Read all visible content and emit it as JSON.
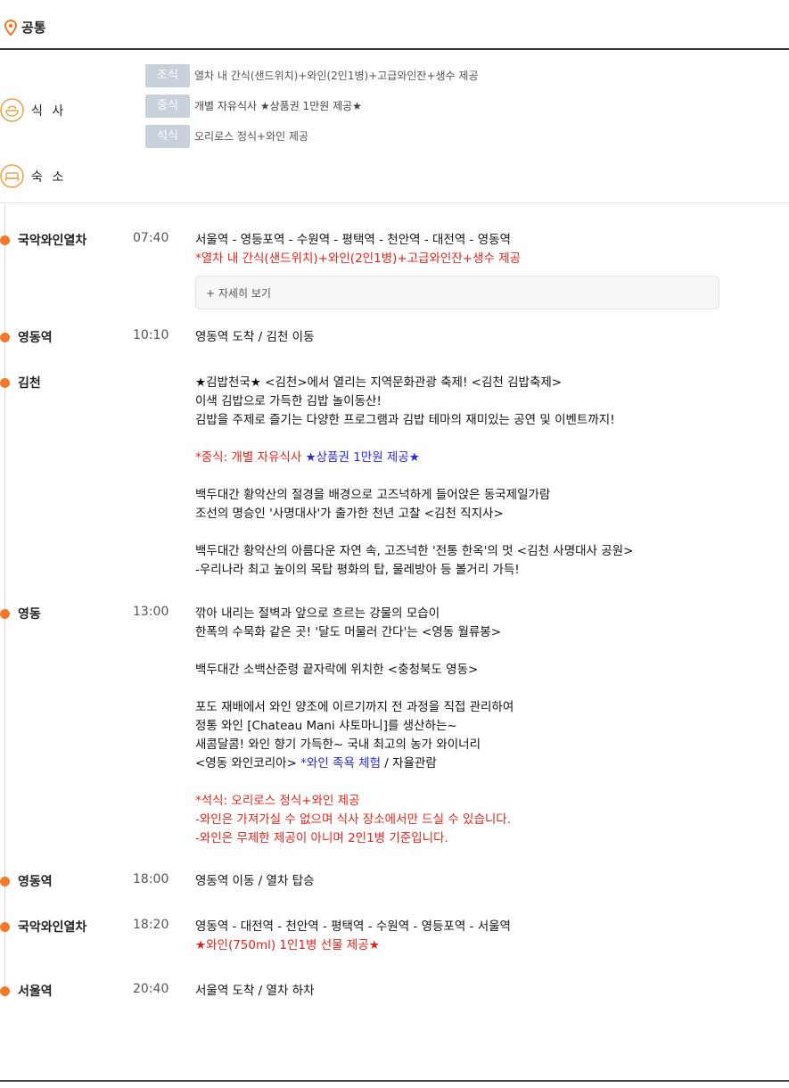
{
  "header": {
    "title": "공통"
  },
  "meals": {
    "label": "식 사",
    "rows": [
      {
        "tag": "조식",
        "text": "열차 내 간식(샌드위치)+와인(2인1병)+고급와인잔+생수 제공"
      },
      {
        "tag": "중식",
        "text": "개별 자유식사 ★상품권 1만원 제공★"
      },
      {
        "tag": "석식",
        "text": "오리로스 정식+와인 제공"
      }
    ]
  },
  "lodging": {
    "label": "숙 소"
  },
  "colors": {
    "accent": "#f07a2a",
    "red": "#e0241b",
    "blue": "#2a2ad6",
    "tag_bg": "#c8d0da"
  },
  "stops": [
    {
      "place": "국악와인열차",
      "time": "07:40",
      "line1": "서울역 - 영등포역 - 수원역 - 평택역 - 천안역 - 대전역 - 영동역",
      "line2": "*열차 내 간식(샌드위치)+와인(2인1병)+고급와인잔+생수 제공",
      "more": "+ 자세히 보기"
    },
    {
      "place": "영동역",
      "time": "10:10",
      "line1": "영동역 도착 / 김천 이동"
    },
    {
      "place": "김천",
      "time": "",
      "l1": "★김밥천국★ <김천>에서 열리는 지역문화관광 축제! <김천 김밥축제>",
      "l2": "이색 김밥으로 가득한 김밥 놀이동산!",
      "l3": "김밥을 주제로 즐기는 다양한 프로그램과 김밥 테마의 재미있는 공연 및 이벤트까지!",
      "l4a": "*중식: 개별 자유식사 ",
      "l4b": "★상품권 1만원 제공★",
      "l5": "백두대간 황악산의 절경을 배경으로 고즈넉하게 들어앉은 동국제일가람",
      "l6": "조선의 명승인 '사명대사'가 출가한 천년 고찰 <김천 직지사>",
      "l7": "백두대간 황악산의 아름다운 자연 속, 고즈넉한 '전통 한옥'의 멋 <김천 사명대사 공원>",
      "l8": "-우리나라 최고 높이의 목탑 평화의 탑, 물레방아 등 볼거리 가득!"
    },
    {
      "place": "영동",
      "time": "13:00",
      "l1": "깎아 내리는 절벽과 앞으로 흐르는 강물의 모습이",
      "l2": "한폭의 수묵화 같은 곳! '달도 머물러 간다'는 <영동 월류봉>",
      "l3": "백두대간 소백산준령 끝자락에 위치한 <충청북도 영동>",
      "l4": "포도 재배에서 와인 양조에 이르기까지 전 과정을 직접 관리하여",
      "l5": "정통 와인 [Chateau Mani 샤토마니]를 생산하는~",
      "l6": "새콤달콤! 와인 향기 가득한~ 국내 최고의 농가 와이너리",
      "l7a": "<영동 와인코리아> ",
      "l7b": "*와인 족욕 체험",
      "l7c": " / 자율관람",
      "l8": "*석식: 오리로스 정식+와인 제공",
      "l9": "-와인은 가져가실 수 없으며 식사 장소에서만 드실 수 있습니다.",
      "l10": "-와인은 무제한 제공이 아니며 2인1병 기준입니다."
    },
    {
      "place": "영동역",
      "time": "18:00",
      "line1": "영동역 이동 / 열차 탑승"
    },
    {
      "place": "국악와인열차",
      "time": "18:20",
      "line1": "영동역 - 대전역 - 천안역 - 평택역 - 수원역 - 영등포역 - 서울역",
      "line2": "★와인(750ml) 1인1병 선물 제공★"
    },
    {
      "place": "서울역",
      "time": "20:40",
      "line1": "서울역 도착 / 열차 하차"
    }
  ]
}
